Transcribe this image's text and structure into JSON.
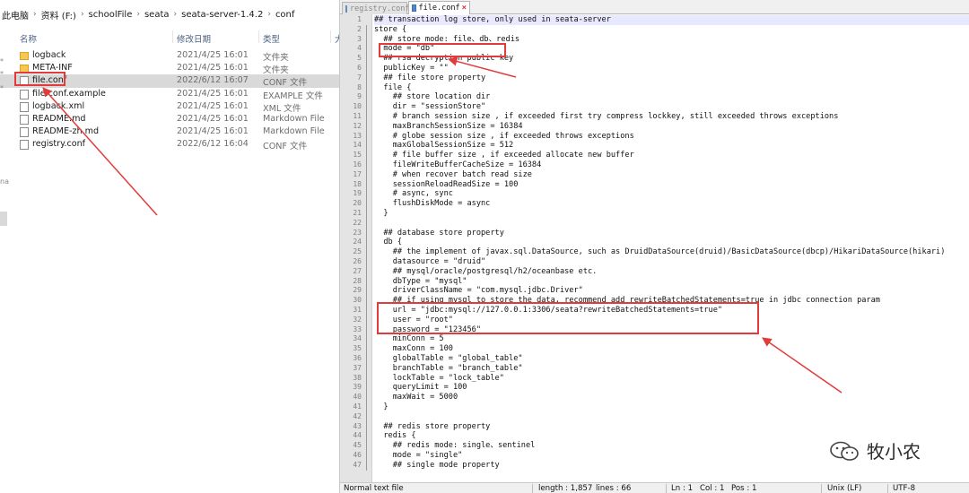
{
  "explorer": {
    "breadcrumb": [
      "此电脑",
      "资料 (F:)",
      "schoolFile",
      "seata",
      "seata-server-1.4.2",
      "conf"
    ],
    "columns": {
      "name": "名称",
      "date": "修改日期",
      "type": "类型",
      "size": "大"
    },
    "files": [
      {
        "name": "logback",
        "date": "2021/4/25 16:01",
        "type": "文件夹",
        "icon": "folder-icon"
      },
      {
        "name": "META-INF",
        "date": "2021/4/25 16:01",
        "type": "文件夹",
        "icon": "folder-icon"
      },
      {
        "name": "file.conf",
        "date": "2022/6/12 16:07",
        "type": "CONF 文件",
        "icon": "file-icon",
        "selected": true
      },
      {
        "name": "file.conf.example",
        "date": "2021/4/25 16:01",
        "type": "EXAMPLE 文件",
        "icon": "file-icon"
      },
      {
        "name": "logback.xml",
        "date": "2021/4/25 16:01",
        "type": "XML 文件",
        "icon": "xml-file-icon"
      },
      {
        "name": "README.md",
        "date": "2021/4/25 16:01",
        "type": "Markdown File",
        "icon": "markdown-file-icon"
      },
      {
        "name": "README-zh.md",
        "date": "2021/4/25 16:01",
        "type": "Markdown File",
        "icon": "markdown-file-icon"
      },
      {
        "name": "registry.conf",
        "date": "2022/6/12 16:04",
        "type": "CONF 文件",
        "icon": "file-icon"
      }
    ],
    "left_strip": [
      "*",
      "*",
      "*",
      "na"
    ]
  },
  "editor": {
    "tabs": [
      {
        "label": "registry.conf",
        "active": false
      },
      {
        "label": "file.conf",
        "active": true
      }
    ],
    "first_line_number": 1,
    "current_line": 1,
    "lines": [
      "## transaction log store, only used in seata-server",
      "store {",
      "  ## store mode: file、db、redis",
      "  mode = \"db\"",
      "  ## rsa decryption public key",
      "  publicKey = \"\"",
      "  ## file store property",
      "  file {",
      "    ## store location dir",
      "    dir = \"sessionStore\"",
      "    # branch session size , if exceeded first try compress lockkey, still exceeded throws exceptions",
      "    maxBranchSessionSize = 16384",
      "    # globe session size , if exceeded throws exceptions",
      "    maxGlobalSessionSize = 512",
      "    # file buffer size , if exceeded allocate new buffer",
      "    fileWriteBufferCacheSize = 16384",
      "    # when recover batch read size",
      "    sessionReloadReadSize = 100",
      "    # async, sync",
      "    flushDiskMode = async",
      "  }",
      "",
      "  ## database store property",
      "  db {",
      "    ## the implement of javax.sql.DataSource, such as DruidDataSource(druid)/BasicDataSource(dbcp)/HikariDataSource(hikari)",
      "    datasource = \"druid\"",
      "    ## mysql/oracle/postgresql/h2/oceanbase etc.",
      "    dbType = \"mysql\"",
      "    driverClassName = \"com.mysql.jdbc.Driver\"",
      "    ## if using mysql to store the data, recommend add rewriteBatchedStatements=true in jdbc connection param",
      "    url = \"jdbc:mysql://127.0.0.1:3306/seata?rewriteBatchedStatements=true\"",
      "    user = \"root\"",
      "    password = \"123456\"",
      "    minConn = 5",
      "    maxConn = 100",
      "    globalTable = \"global_table\"",
      "    branchTable = \"branch_table\"",
      "    lockTable = \"lock_table\"",
      "    queryLimit = 100",
      "    maxWait = 5000",
      "  }",
      "",
      "  ## redis store property",
      "  redis {",
      "    ## redis mode: single、sentinel",
      "    mode = \"single\"",
      "    ## single mode property"
    ]
  },
  "statusbar": {
    "file_type": "Normal text file",
    "length": "length : 1,857",
    "lines": "lines : 66",
    "ln": "Ln : 1",
    "col": "Col : 1",
    "pos": "Pos : 1",
    "eol": "Unix (LF)",
    "encoding": "UTF-8"
  },
  "watermark": {
    "text": "牧小农",
    "icon": "wechat-logo-icon"
  },
  "colors": {
    "annotation": "#e23b3b",
    "selected_row": "#d9d9d9",
    "gutter": "#e4e4e4"
  }
}
